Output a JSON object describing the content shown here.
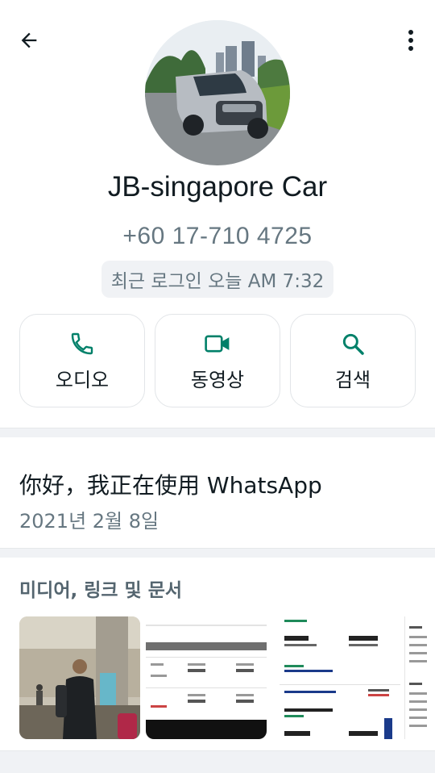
{
  "header": {
    "back_icon": "arrow-left-icon",
    "menu_icon": "more-vert-icon"
  },
  "contact": {
    "name": "JB-singapore Car",
    "phone": "+60 17-710 4725",
    "last_seen": "최근 로그인 오늘 AM 7:32"
  },
  "actions": [
    {
      "label": "오디오",
      "icon": "phone-icon"
    },
    {
      "label": "동영상",
      "icon": "video-camera-icon"
    },
    {
      "label": "검색",
      "icon": "search-icon"
    }
  ],
  "about": {
    "text": "你好，我正在使用 WhatsApp",
    "date": "2021년 2월 8일"
  },
  "media": {
    "title": "미디어, 링크 및 문서"
  },
  "colors": {
    "accent": "#008069",
    "text_primary": "#111b21",
    "text_secondary": "#667781",
    "divider": "#f0f2f5"
  }
}
